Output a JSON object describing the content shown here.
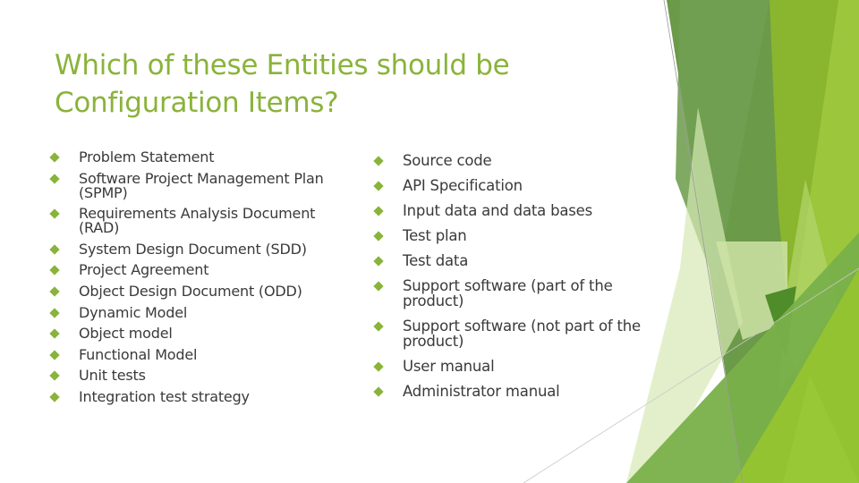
{
  "slide": {
    "title": "Which of these Entities should be Configuration Items?",
    "accent_color": "#8ab33a",
    "text_color": "#3a3a3a",
    "bullet_icon": "diamond-bullet-icon",
    "left_column": [
      "Problem Statement",
      "Software Project Management Plan (SPMP)",
      "Requirements Analysis Document (RAD)",
      "System Design Document (SDD)",
      "Project Agreement",
      "Object Design Document  (ODD)",
      "Dynamic Model",
      "Object model",
      "Functional Model",
      "Unit tests",
      "Integration test strategy"
    ],
    "right_column": [
      "Source code",
      "API Specification",
      "Input data and data bases",
      "Test plan",
      "Test data",
      "Support software (part of the product)",
      "Support software (not part of the product)",
      "User manual",
      "Administrator manual"
    ]
  }
}
